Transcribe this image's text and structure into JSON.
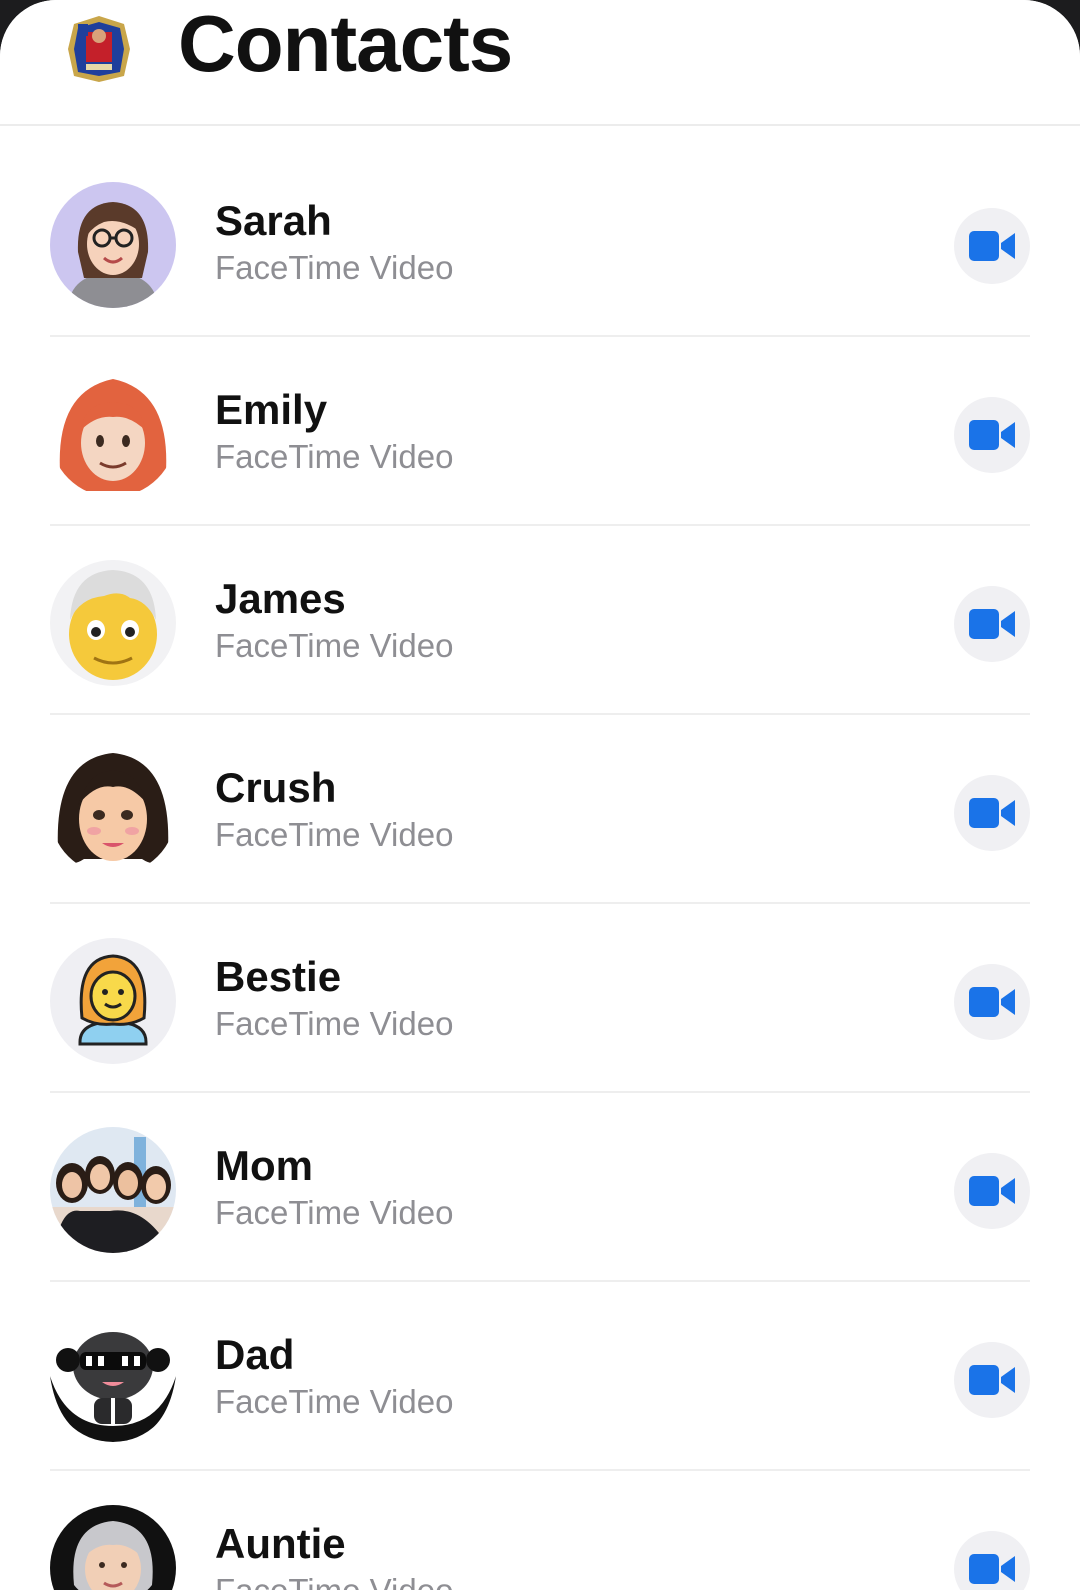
{
  "header": {
    "title": "Contacts",
    "avatar_icon": "profile-card-icon"
  },
  "accent_color": "#1a73e8",
  "contacts": [
    {
      "name": "Sarah",
      "subtitle": "FaceTime Video",
      "avatar": "woman-glasses-avatar"
    },
    {
      "name": "Emily",
      "subtitle": "FaceTime Video",
      "avatar": "red-hair-woman-avatar"
    },
    {
      "name": "James",
      "subtitle": "FaceTime Video",
      "avatar": "older-man-avatar"
    },
    {
      "name": "Crush",
      "subtitle": "FaceTime Video",
      "avatar": "dark-hair-woman-avatar"
    },
    {
      "name": "Bestie",
      "subtitle": "FaceTime Video",
      "avatar": "woman-emoji-avatar"
    },
    {
      "name": "Mom",
      "subtitle": "FaceTime Video",
      "avatar": "group-photo-avatar"
    },
    {
      "name": "Dad",
      "subtitle": "FaceTime Video",
      "avatar": "sunglasses-character-avatar"
    },
    {
      "name": "Auntie",
      "subtitle": "FaceTime Video",
      "avatar": "grey-hair-woman-avatar"
    }
  ]
}
